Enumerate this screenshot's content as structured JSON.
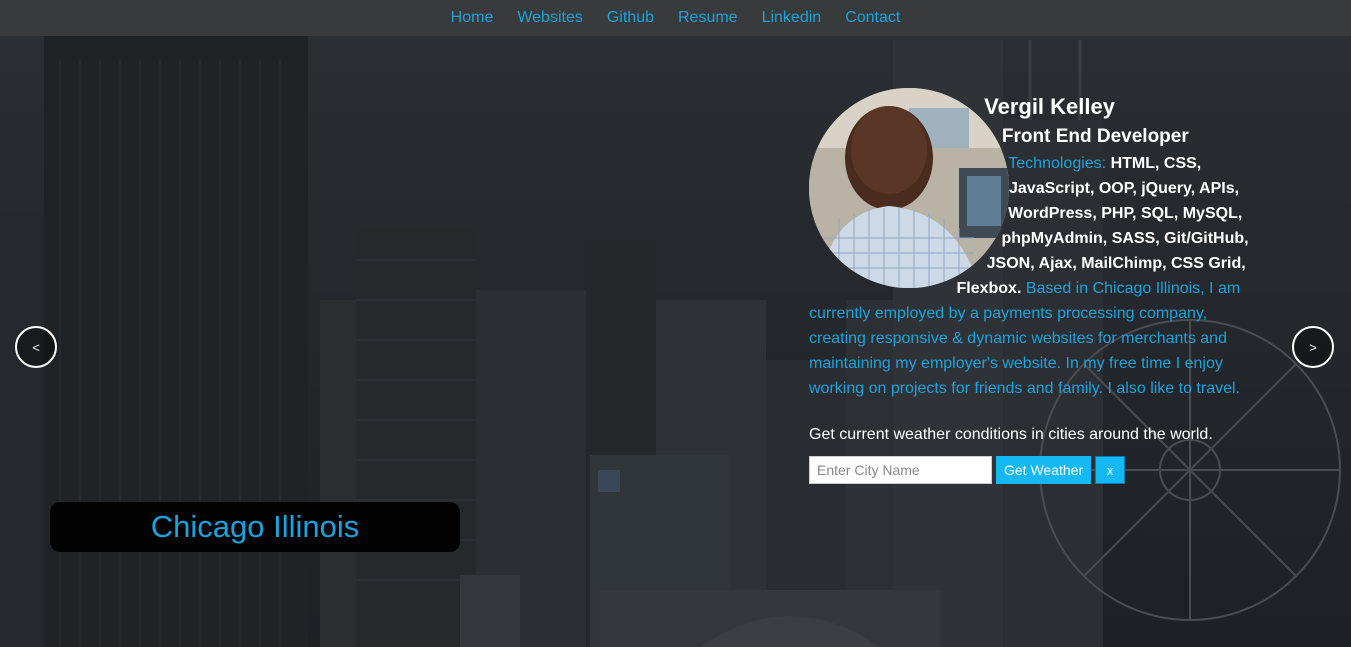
{
  "nav": {
    "items": [
      {
        "label": "Home"
      },
      {
        "label": "Websites"
      },
      {
        "label": "Github"
      },
      {
        "label": "Resume"
      },
      {
        "label": "Linkedin"
      },
      {
        "label": "Contact"
      }
    ]
  },
  "slider": {
    "prev_label": "<",
    "next_label": ">",
    "caption": "Chicago Illinois"
  },
  "profile": {
    "name": "Vergil Kelley",
    "role": "Front End Developer",
    "tech_heading": "Technologies:",
    "tech_list": "HTML, CSS, JavaScript, OOP, jQuery, APIs, WordPress, PHP, SQL, MySQL, phpMyAdmin, SASS, Git/GitHub, JSON, Ajax, MailChimp, CSS Grid, Flexbox.",
    "about": "Based in Chicago Illinois, I am currently employed by a payments processing company, creating responsive & dynamic websites for merchants and maintaining my employer's website. In my free time I enjoy working on projects for friends and family. I also like to travel."
  },
  "weather": {
    "prompt": "Get current weather conditions in cities around the world.",
    "input_placeholder": "Enter City Name",
    "input_value": "",
    "button_label": "Get Weather",
    "clear_label": "x"
  },
  "colors": {
    "accent": "#1aa3dc",
    "button": "#14b8f2",
    "nav_bg": "#3c3c3e",
    "caption_bg": "#000000"
  }
}
